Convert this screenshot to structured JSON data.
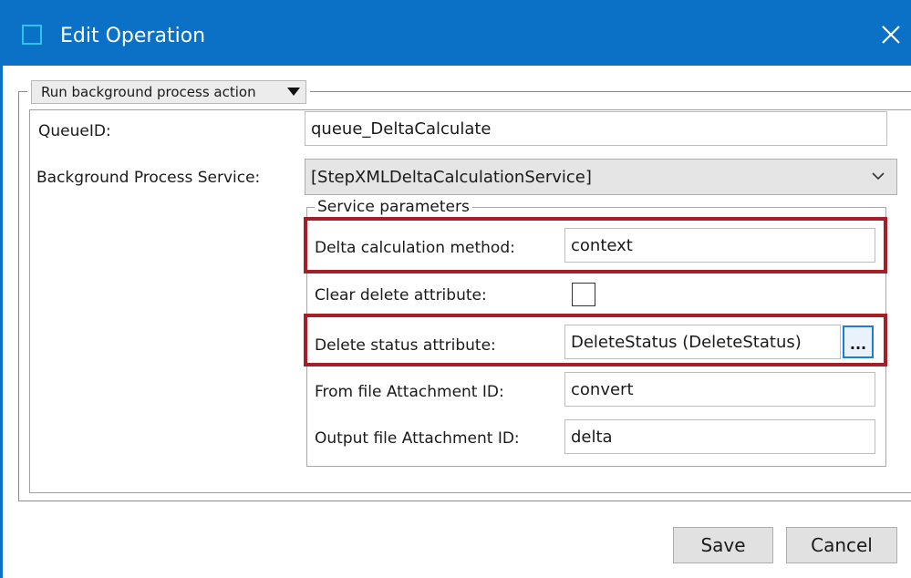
{
  "window": {
    "title": "Edit Operation"
  },
  "action": {
    "label": "Run background process action"
  },
  "form": {
    "queue_label": "QueueID:",
    "queue_value": "queue_DeltaCalculate",
    "service_label": "Background Process Service:",
    "service_value": "[StepXMLDeltaCalculationService]"
  },
  "service_parameters": {
    "legend": "Service parameters",
    "delta_method_label": "Delta calculation method:",
    "delta_method_value": "context",
    "clear_delete_label": "Clear delete attribute:",
    "clear_delete_checked": false,
    "delete_status_label": "Delete status attribute:",
    "delete_status_value": "DeleteStatus (DeleteStatus)",
    "browse_label": "...",
    "from_file_label": "From file Attachment ID:",
    "from_file_value": "convert",
    "output_file_label": "Output file Attachment ID:",
    "output_file_value": "delta"
  },
  "buttons": {
    "save": "Save",
    "cancel": "Cancel"
  },
  "colors": {
    "titlebar": "#0a71c6",
    "highlight": "#a51f27",
    "browse_border": "#1a7fd4"
  },
  "icons": {
    "app": "window-icon",
    "close": "close-icon",
    "dropdown": "chevron-down-icon",
    "action_menu": "triangle-down-icon"
  }
}
